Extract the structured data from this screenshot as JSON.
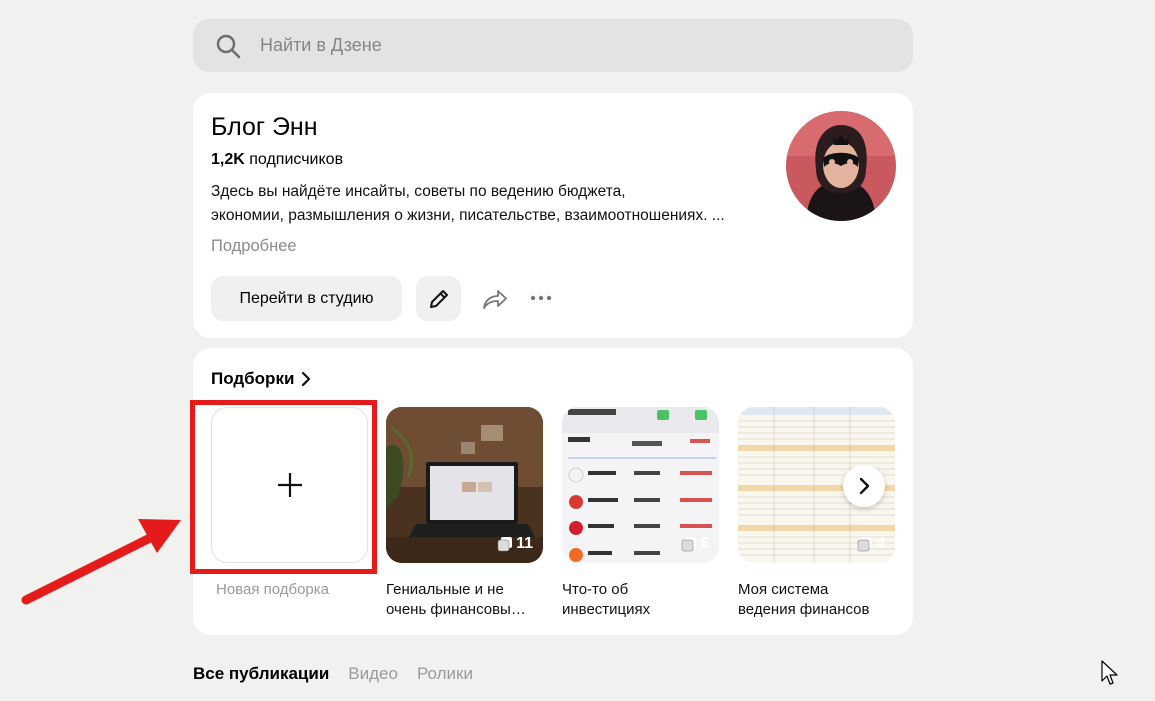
{
  "search": {
    "placeholder": "Найти в Дзене"
  },
  "profile": {
    "title": "Блог Энн",
    "subscribers_count": "1,2K",
    "subscribers_label": " подписчиков",
    "description_line1": "Здесь вы найдёте инсайты, советы по ведению бюджета,",
    "description_line2": "экономии, размышления о жизни, писательстве, взаимоотношениях. ...",
    "more_link": "Подробнее",
    "studio_button": "Перейти в студию",
    "icons": [
      "pencil-icon",
      "share-icon",
      "more-dots-icon"
    ]
  },
  "collections": {
    "header": "Подборки",
    "new_collection": "Новая подборка",
    "items": [
      {
        "caption_line1": "Гениальные и не",
        "caption_line2": "очень финансовы…",
        "count": "11"
      },
      {
        "caption_line1": "Что-то об",
        "caption_line2": "инвестициях",
        "count": "6"
      },
      {
        "caption_line1": "Моя система",
        "caption_line2": "ведения финансов",
        "count": "4"
      }
    ]
  },
  "tabs": {
    "all": "Все публикации",
    "video": "Видео",
    "shorts": "Ролики"
  },
  "colors": {
    "background": "#f1f1f0",
    "highlight": "#e51b1b",
    "avatar_bg": "#c9595f"
  }
}
